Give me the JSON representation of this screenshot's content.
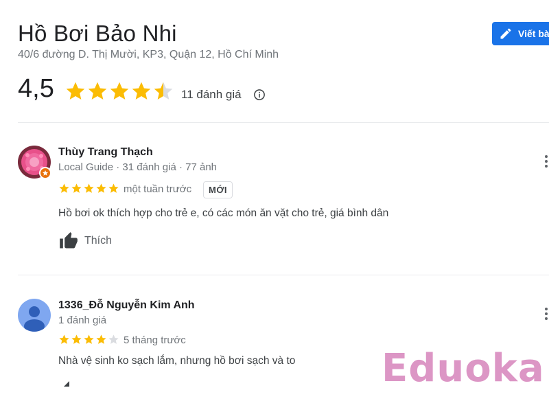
{
  "place": {
    "title": "Hồ Bơi Bảo Nhi",
    "address": "40/6 đường D. Thị Mười, KP3, Quận 12, Hồ Chí Minh",
    "write_review_label": "Viết bài",
    "rating_value": "4,5",
    "rating_stars": 4.5,
    "review_count_label": "11 đánh giá",
    "info_icon": "info-icon"
  },
  "colors": {
    "star": "#fbbc04",
    "star_empty": "#dadce0",
    "button": "#1a73e8",
    "guide_badge": "#e8710a",
    "watermark": "#d98bbf"
  },
  "reviews": [
    {
      "name": "Thùy Trang Thạch",
      "meta": "Local Guide · 31 đánh giá · 77 ảnh",
      "stars": 5,
      "time": "một tuần trước",
      "badge": "MỚI",
      "text": "Hồ bơi ok thích hợp cho trẻ e, có các món ăn vặt cho trẻ, giá bình dân",
      "like_label": "Thích",
      "avatar": "flower-photo-avatar"
    },
    {
      "name": "1336_Đỗ Nguyễn Kim Anh",
      "meta": "1 đánh giá",
      "stars": 4,
      "time": "5 tháng trước",
      "text": "Nhà vệ sinh ko sạch lắm, nhưng hồ bơi sạch và to",
      "avatar": "default-person-avatar"
    }
  ],
  "watermark": "Eduoka"
}
